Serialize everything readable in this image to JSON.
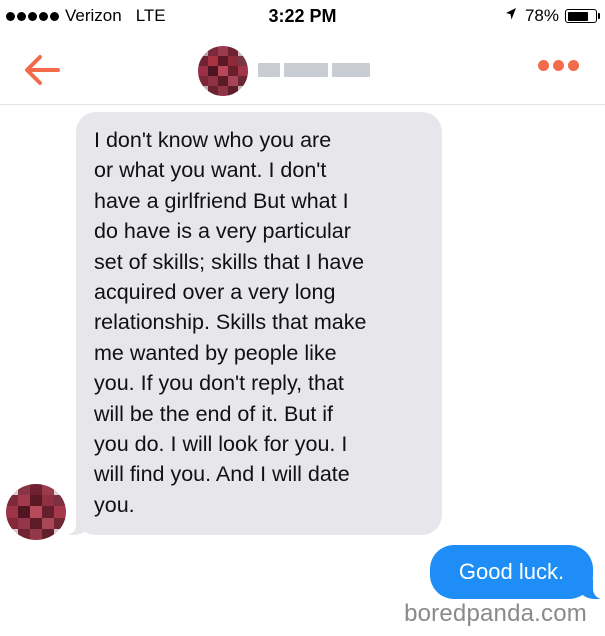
{
  "status_bar": {
    "carrier": "Verizon",
    "network": "LTE",
    "time": "3:22 PM",
    "battery_percent": "78%",
    "battery_level": 0.78
  },
  "header": {
    "contact_name": "",
    "accent_color": "#f26b4b"
  },
  "messages": [
    {
      "direction": "incoming",
      "text": "I don't know who you  are\nor what you want. I don't\nhave a girlfriend But what I\ndo have is a very particular\nset of skills; skills that I have\nacquired over a very long\nrelationship. Skills that make\nme wanted by people like\nyou. If you don't reply, that\nwill be the end of it. But if\nyou do. I will look for you. I\nwill find you. And I will date\nyou."
    },
    {
      "direction": "outgoing",
      "text": "Good luck."
    }
  ],
  "watermark": "boredpanda.com",
  "colors": {
    "incoming_bubble": "#e6e6eb",
    "outgoing_bubble": "#1e8ef6",
    "divider": "#e3e3e3"
  }
}
